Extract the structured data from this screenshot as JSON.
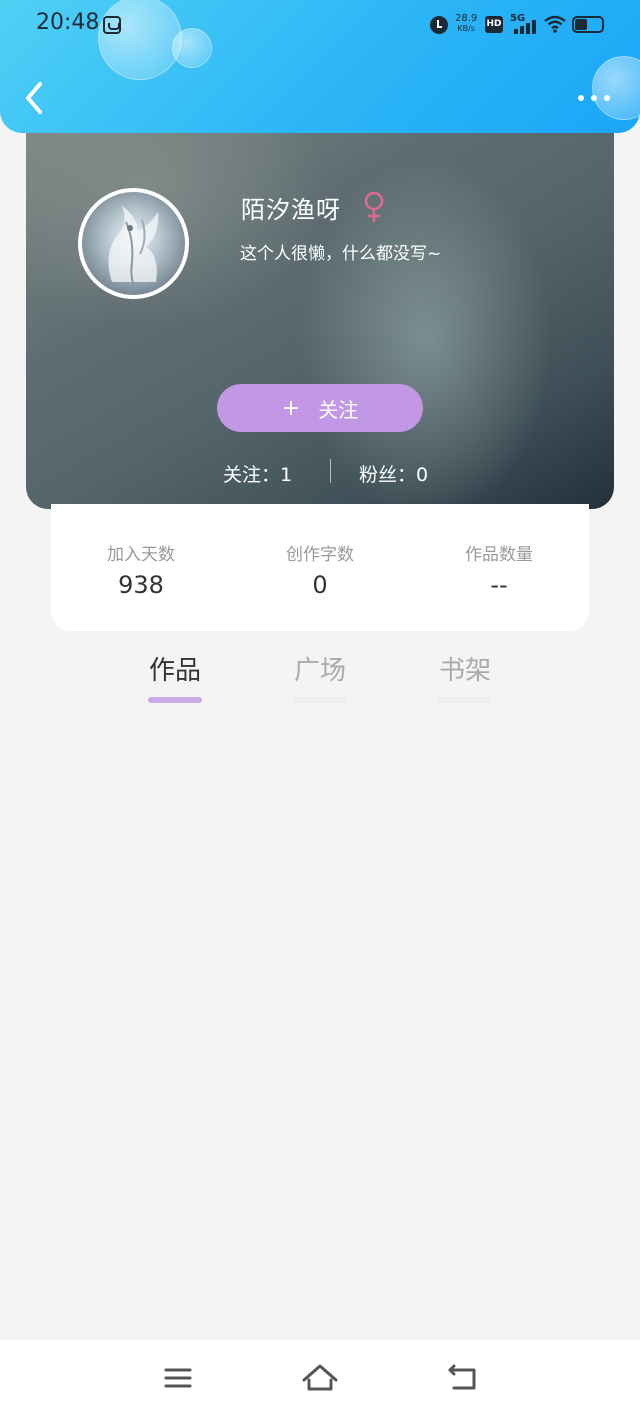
{
  "status_bar": {
    "time": "20:48",
    "network_speed_value": "28.9",
    "network_speed_unit": "KB/s",
    "hd_label": "HD",
    "network_label": "5G",
    "battery_level": 0.45,
    "icons": [
      "app-notification-icon",
      "alarm-icon",
      "signal-icon",
      "wifi-icon",
      "battery-icon"
    ]
  },
  "nav": {
    "back_icon": "chevron-left-icon",
    "more_icon": "more-horizontal-icon"
  },
  "profile": {
    "name": "陌汐渔呀",
    "gender_icon": "female-icon",
    "bio": "这个人很懒，什么都没写~",
    "follow_button": {
      "icon": "plus",
      "plus": "+",
      "label": "关注"
    },
    "following": "关注：1",
    "followers": "粉丝：0"
  },
  "stats": [
    {
      "label": "加入天数",
      "value": "938"
    },
    {
      "label": "创作字数",
      "value": "0"
    },
    {
      "label": "作品数量",
      "value": "--"
    }
  ],
  "tabs": [
    {
      "label": "作品",
      "active": true
    },
    {
      "label": "广场",
      "active": false
    },
    {
      "label": "书架",
      "active": false
    }
  ],
  "colors": {
    "header_gradient_start": "#4fd0f5",
    "header_gradient_end": "#1aa6f8",
    "follow_button": "#c197e6",
    "active_tab_underline": "#c9aae6",
    "gender_female": "#e06a8e",
    "page_background": "#f4f4f4"
  },
  "bottom_nav": {
    "items": [
      "menu-icon",
      "home-icon",
      "back-icon"
    ]
  }
}
